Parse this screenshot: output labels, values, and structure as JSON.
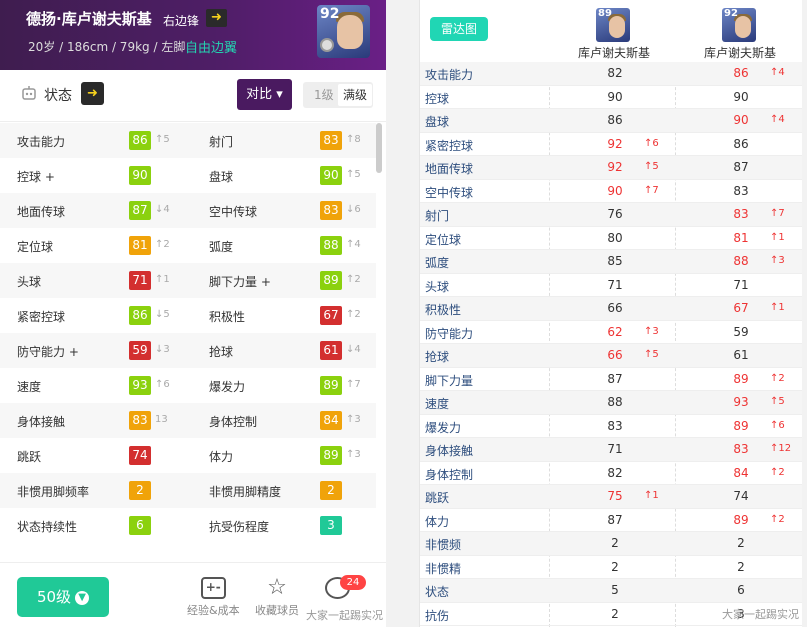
{
  "player": {
    "name": "德扬·库卢谢夫斯基",
    "position": "右边锋",
    "info": "20岁 / 186cm / 79kg / 左脚",
    "skill": "自由边翼",
    "rating": "92"
  },
  "status": {
    "label": "状态",
    "compare_label": "对比",
    "level_1": "1级",
    "level_max": "满级"
  },
  "attributes": [
    [
      {
        "label": "攻击能力",
        "value": "86",
        "delta": "↑5",
        "color": "#8bd10e"
      },
      {
        "label": "射门",
        "value": "83",
        "delta": "↑8",
        "color": "#f0a30a"
      }
    ],
    [
      {
        "label": "控球 +",
        "value": "90",
        "delta": "",
        "color": "#8bd10e"
      },
      {
        "label": "盘球",
        "value": "90",
        "delta": "↑5",
        "color": "#8bd10e"
      }
    ],
    [
      {
        "label": "地面传球",
        "value": "87",
        "delta": "↓4",
        "color": "#8bd10e"
      },
      {
        "label": "空中传球",
        "value": "83",
        "delta": "↓6",
        "color": "#f0a30a"
      }
    ],
    [
      {
        "label": "定位球",
        "value": "81",
        "delta": "↑2",
        "color": "#f0a30a"
      },
      {
        "label": "弧度",
        "value": "88",
        "delta": "↑4",
        "color": "#8bd10e"
      }
    ],
    [
      {
        "label": "头球",
        "value": "71",
        "delta": "↑1",
        "color": "#d32f2f"
      },
      {
        "label": "脚下力量 +",
        "value": "89",
        "delta": "↑2",
        "color": "#8bd10e"
      }
    ],
    [
      {
        "label": "紧密控球",
        "value": "86",
        "delta": "↓5",
        "color": "#8bd10e"
      },
      {
        "label": "积极性",
        "value": "67",
        "delta": "↑2",
        "color": "#d32f2f"
      }
    ],
    [
      {
        "label": "防守能力 +",
        "value": "59",
        "delta": "↓3",
        "color": "#d32f2f"
      },
      {
        "label": "抢球",
        "value": "61",
        "delta": "↓4",
        "color": "#d32f2f"
      }
    ],
    [
      {
        "label": "速度",
        "value": "93",
        "delta": "↑6",
        "color": "#8bd10e"
      },
      {
        "label": "爆发力",
        "value": "89",
        "delta": "↑7",
        "color": "#8bd10e"
      }
    ],
    [
      {
        "label": "身体接触",
        "value": "83",
        "delta": "13",
        "color": "#f0a30a"
      },
      {
        "label": "身体控制",
        "value": "84",
        "delta": "↑3",
        "color": "#f0a30a"
      }
    ],
    [
      {
        "label": "跳跃",
        "value": "74",
        "delta": "",
        "color": "#d32f2f"
      },
      {
        "label": "体力",
        "value": "89",
        "delta": "↑3",
        "color": "#8bd10e"
      }
    ],
    [
      {
        "label": "非惯用脚频率",
        "value": "2",
        "delta": "",
        "color": "#f0a30a"
      },
      {
        "label": "非惯用脚精度",
        "value": "2",
        "delta": "",
        "color": "#f0a30a"
      }
    ],
    [
      {
        "label": "状态持续性",
        "value": "6",
        "delta": "",
        "color": "#8bd10e"
      },
      {
        "label": "抗受伤程度",
        "value": "3",
        "delta": "",
        "color": "#20c997"
      }
    ]
  ],
  "bottom": {
    "level_button": "50级",
    "action_1": "经验&成本",
    "action_2": "收藏球员",
    "badge_count": "24",
    "watermark": "大家一起踢实况"
  },
  "compare": {
    "tab_label": "雷达图",
    "p1": {
      "rating": "89",
      "name": "库卢谢夫斯基"
    },
    "p2": {
      "rating": "92",
      "name": "库卢谢夫斯基"
    },
    "rows": [
      {
        "label": "攻击能力",
        "v1": "82",
        "d1": "",
        "red1": false,
        "v2": "86",
        "d2": "↑4",
        "red2": true
      },
      {
        "label": "控球",
        "v1": "90",
        "d1": "",
        "red1": false,
        "v2": "90",
        "d2": "",
        "red2": false
      },
      {
        "label": "盘球",
        "v1": "86",
        "d1": "",
        "red1": false,
        "v2": "90",
        "d2": "↑4",
        "red2": true
      },
      {
        "label": "紧密控球",
        "v1": "92",
        "d1": "↑6",
        "red1": true,
        "v2": "86",
        "d2": "",
        "red2": false
      },
      {
        "label": "地面传球",
        "v1": "92",
        "d1": "↑5",
        "red1": true,
        "v2": "87",
        "d2": "",
        "red2": false
      },
      {
        "label": "空中传球",
        "v1": "90",
        "d1": "↑7",
        "red1": true,
        "v2": "83",
        "d2": "",
        "red2": false
      },
      {
        "label": "射门",
        "v1": "76",
        "d1": "",
        "red1": false,
        "v2": "83",
        "d2": "↑7",
        "red2": true
      },
      {
        "label": "定位球",
        "v1": "80",
        "d1": "",
        "red1": false,
        "v2": "81",
        "d2": "↑1",
        "red2": true
      },
      {
        "label": "弧度",
        "v1": "85",
        "d1": "",
        "red1": false,
        "v2": "88",
        "d2": "↑3",
        "red2": true
      },
      {
        "label": "头球",
        "v1": "71",
        "d1": "",
        "red1": false,
        "v2": "71",
        "d2": "",
        "red2": false
      },
      {
        "label": "积极性",
        "v1": "66",
        "d1": "",
        "red1": false,
        "v2": "67",
        "d2": "↑1",
        "red2": true
      },
      {
        "label": "防守能力",
        "v1": "62",
        "d1": "↑3",
        "red1": true,
        "v2": "59",
        "d2": "",
        "red2": false
      },
      {
        "label": "抢球",
        "v1": "66",
        "d1": "↑5",
        "red1": true,
        "v2": "61",
        "d2": "",
        "red2": false
      },
      {
        "label": "脚下力量",
        "v1": "87",
        "d1": "",
        "red1": false,
        "v2": "89",
        "d2": "↑2",
        "red2": true
      },
      {
        "label": "速度",
        "v1": "88",
        "d1": "",
        "red1": false,
        "v2": "93",
        "d2": "↑5",
        "red2": true
      },
      {
        "label": "爆发力",
        "v1": "83",
        "d1": "",
        "red1": false,
        "v2": "89",
        "d2": "↑6",
        "red2": true
      },
      {
        "label": "身体接触",
        "v1": "71",
        "d1": "",
        "red1": false,
        "v2": "83",
        "d2": "↑12",
        "red2": true
      },
      {
        "label": "身体控制",
        "v1": "82",
        "d1": "",
        "red1": false,
        "v2": "84",
        "d2": "↑2",
        "red2": true
      },
      {
        "label": "跳跃",
        "v1": "75",
        "d1": "↑1",
        "red1": true,
        "v2": "74",
        "d2": "",
        "red2": false
      },
      {
        "label": "体力",
        "v1": "87",
        "d1": "",
        "red1": false,
        "v2": "89",
        "d2": "↑2",
        "red2": true
      },
      {
        "label": "非惯频",
        "v1": "2",
        "d1": "",
        "red1": false,
        "v2": "2",
        "d2": "",
        "red2": false
      },
      {
        "label": "非惯精",
        "v1": "2",
        "d1": "",
        "red1": false,
        "v2": "2",
        "d2": "",
        "red2": false
      },
      {
        "label": "状态",
        "v1": "5",
        "d1": "",
        "red1": false,
        "v2": "6",
        "d2": "",
        "red2": false
      },
      {
        "label": "抗伤",
        "v1": "2",
        "d1": "",
        "red1": false,
        "v2": "3",
        "d2": "",
        "red2": false
      }
    ]
  }
}
